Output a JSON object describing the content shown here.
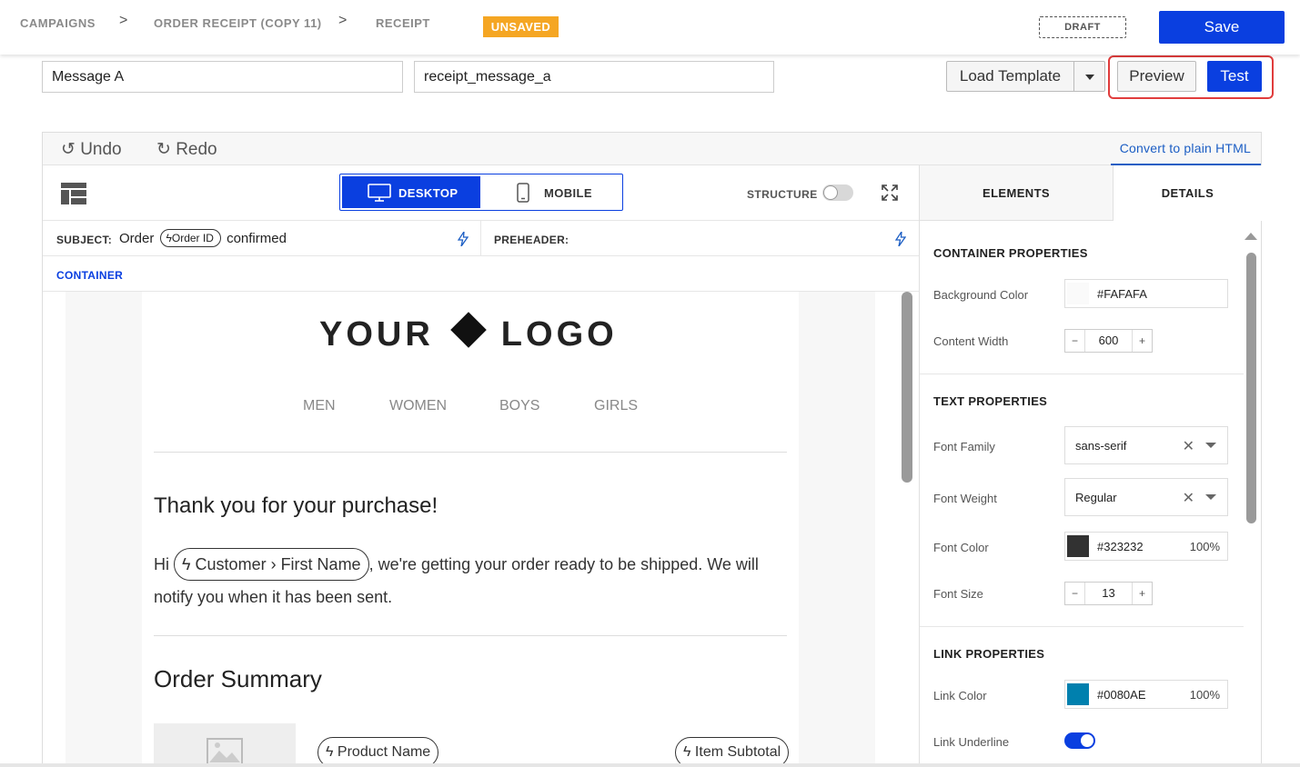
{
  "breadcrumb": {
    "items": [
      "CAMPAIGNS",
      "ORDER RECEIPT (COPY 11)",
      "RECEIPT"
    ],
    "separator": ">"
  },
  "status": {
    "unsaved": "UNSAVED",
    "draft": "DRAFT"
  },
  "toolbar": {
    "save_label": "Save",
    "load_template_label": "Load Template",
    "preview_label": "Preview",
    "test_label": "Test"
  },
  "message": {
    "name": "Message A",
    "key": "receipt_message_a"
  },
  "history": {
    "undo_label": "Undo",
    "redo_label": "Redo",
    "undo_glyph": "↺",
    "redo_glyph": "↻",
    "convert_label": "Convert to plain HTML"
  },
  "canvas": {
    "desktop_label": "DESKTOP",
    "mobile_label": "MOBILE",
    "structure_label": "STRUCTURE",
    "subject_label": "SUBJECT:",
    "subject_before": "Order",
    "subject_pill": "Order ID",
    "subject_after": "confirmed",
    "preheader_label": "PREHEADER:",
    "container_label": "CONTAINER"
  },
  "email": {
    "logo_left": "YOUR",
    "logo_right": "LOGO",
    "nav": [
      "MEN",
      "WOMEN",
      "BOYS",
      "GIRLS"
    ],
    "thanks": "Thank you for your purchase!",
    "greeting": "Hi",
    "customer_pill": "Customer › First Name",
    "body_rest": ", we're getting your order ready to be shipped. We will notify you when it has been sent.",
    "order_summary": "Order Summary",
    "product_pill": "Product Name",
    "subtotal_pill": "Item Subtotal"
  },
  "panel": {
    "tab_elements": "ELEMENTS",
    "tab_details": "DETAILS",
    "container_title": "CONTAINER PROPERTIES",
    "bg_color_label": "Background Color",
    "bg_color": "#FAFAFA",
    "content_width_label": "Content Width",
    "content_width": "600",
    "text_title": "TEXT PROPERTIES",
    "font_family_label": "Font Family",
    "font_family": "sans-serif",
    "font_weight_label": "Font Weight",
    "font_weight": "Regular",
    "font_color_label": "Font Color",
    "font_color": "#323232",
    "font_color_pct": "100%",
    "font_size_label": "Font Size",
    "font_size": "13",
    "link_title": "LINK PROPERTIES",
    "link_color_label": "Link Color",
    "link_color": "#0080AE",
    "link_color_pct": "100%",
    "link_underline_label": "Link Underline",
    "stepper_minus": "−",
    "stepper_plus": "+",
    "clear_glyph": "✕"
  },
  "colors": {
    "accent": "#0A3FE0",
    "unsaved_badge": "#F5A623",
    "highlight": "#E03C3C",
    "link_blue": "#1C5EC4"
  }
}
